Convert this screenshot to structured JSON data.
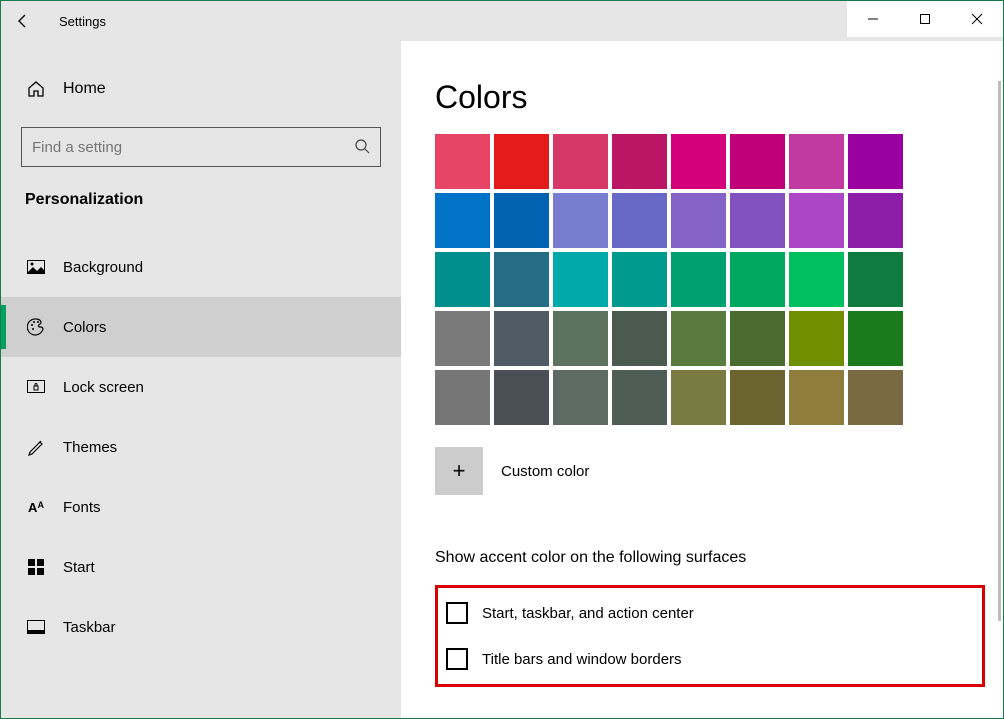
{
  "app": {
    "title": "Settings"
  },
  "sidebar": {
    "home": "Home",
    "search_placeholder": "Find a setting",
    "section": "Personalization",
    "items": [
      {
        "label": "Background"
      },
      {
        "label": "Colors"
      },
      {
        "label": "Lock screen"
      },
      {
        "label": "Themes"
      },
      {
        "label": "Fonts"
      },
      {
        "label": "Start"
      },
      {
        "label": "Taskbar"
      }
    ]
  },
  "page": {
    "title": "Colors",
    "custom_label": "Custom color",
    "accent_heading": "Show accent color on the following surfaces",
    "checkboxes": [
      "Start, taskbar, and action center",
      "Title bars and window borders"
    ],
    "swatches": [
      "#e64565",
      "#e31b1b",
      "#d63867",
      "#bb1565",
      "#d4007b",
      "#bf0079",
      "#c03aa1",
      "#9b00a0",
      "#0073c6",
      "#0062b1",
      "#797dcf",
      "#6869c7",
      "#8562c5",
      "#8251c0",
      "#ab47c7",
      "#8b1da7",
      "#008f8c",
      "#256d85",
      "#00a9aa",
      "#009a8e",
      "#00a073",
      "#00a860",
      "#00bf60",
      "#0f7b3e",
      "#7a7a7a",
      "#515b65",
      "#5e735f",
      "#4a5a4f",
      "#5a7b3e",
      "#4a6b2e",
      "#6f8f00",
      "#1b7a1b",
      "#767676",
      "#4a4f55",
      "#5d6b64",
      "#4f5d57",
      "#7a7b43",
      "#6b6330",
      "#8f7d3e",
      "#7a6a41"
    ]
  }
}
